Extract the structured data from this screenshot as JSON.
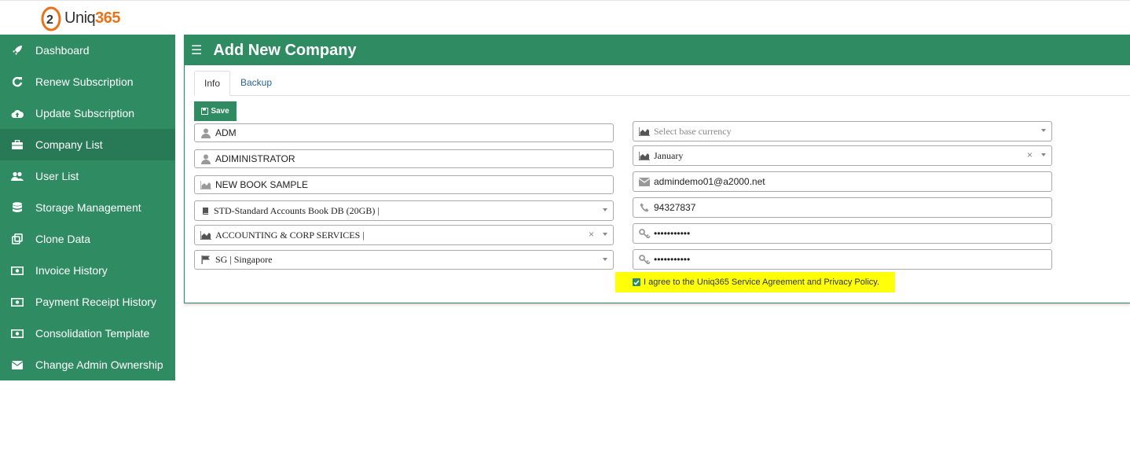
{
  "brand": {
    "logo_text_a": "Uniq",
    "logo_text_b": "365"
  },
  "sidebar": {
    "items": [
      {
        "label": "Dashboard",
        "icon": "rocket-icon"
      },
      {
        "label": "Renew Subscription",
        "icon": "refresh-icon"
      },
      {
        "label": "Update Subscription",
        "icon": "cloud-upload-icon"
      },
      {
        "label": "Company List",
        "icon": "briefcase-icon",
        "active": true
      },
      {
        "label": "User List",
        "icon": "users-icon"
      },
      {
        "label": "Storage Management",
        "icon": "database-icon"
      },
      {
        "label": "Clone Data",
        "icon": "clone-icon"
      },
      {
        "label": "Invoice History",
        "icon": "money-icon"
      },
      {
        "label": "Payment Receipt History",
        "icon": "money-icon"
      },
      {
        "label": "Consolidation Template",
        "icon": "money-icon"
      },
      {
        "label": "Change Admin Ownership",
        "icon": "envelope-icon"
      }
    ]
  },
  "panel": {
    "title": "Add New Company"
  },
  "tabs": [
    {
      "label": "Info"
    },
    {
      "label": "Backup"
    }
  ],
  "toolbar": {
    "save_label": "Save"
  },
  "form": {
    "company_code": "ADM",
    "company_name": "ADIMINISTRATOR",
    "book_name": "NEW BOOK SAMPLE",
    "book_db": "STD-Standard Accounts Book DB (20GB) |",
    "industry": "ACCOUNTING & CORP SERVICES |",
    "country": "SG | Singapore",
    "base_currency_placeholder": "Select base currency",
    "fiscal_month": "January",
    "email": "admindemo01@a2000.net",
    "phone": "94327837",
    "password": "•••••••••••",
    "confirm_password": "•••••••••••",
    "clear_symbol": "×",
    "agree_text": "I agree to the Uniq365 Service Agreement and Privacy Policy."
  },
  "colors": {
    "primary": "#2e8b62",
    "active": "#287a56",
    "highlight": "#ffff0a",
    "link": "#2a6496"
  }
}
